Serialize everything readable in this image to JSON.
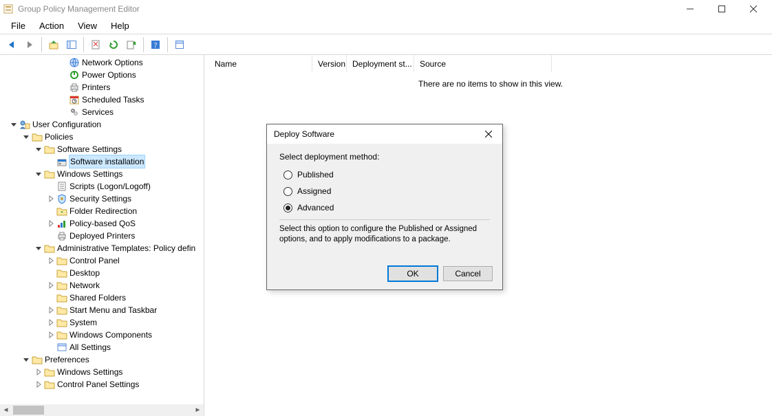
{
  "window": {
    "title": "Group Policy Management Editor"
  },
  "menubar": [
    "File",
    "Action",
    "View",
    "Help"
  ],
  "tree": [
    {
      "d": 4,
      "tw": "",
      "ic": "net",
      "label": "Network Options"
    },
    {
      "d": 4,
      "tw": "",
      "ic": "power",
      "label": "Power Options"
    },
    {
      "d": 4,
      "tw": "",
      "ic": "printer",
      "label": "Printers"
    },
    {
      "d": 4,
      "tw": "",
      "ic": "sched",
      "label": "Scheduled Tasks"
    },
    {
      "d": 4,
      "tw": "",
      "ic": "services",
      "label": "Services"
    },
    {
      "d": 0,
      "tw": "open",
      "ic": "usercfg",
      "label": "User Configuration"
    },
    {
      "d": 1,
      "tw": "open",
      "ic": "folder",
      "label": "Policies"
    },
    {
      "d": 2,
      "tw": "open",
      "ic": "folder",
      "label": "Software Settings",
      "sel": false
    },
    {
      "d": 3,
      "tw": "",
      "ic": "swinst",
      "label": "Software installation",
      "sel": true
    },
    {
      "d": 2,
      "tw": "open",
      "ic": "folder",
      "label": "Windows Settings"
    },
    {
      "d": 3,
      "tw": "",
      "ic": "script",
      "label": "Scripts (Logon/Logoff)"
    },
    {
      "d": 3,
      "tw": "closed",
      "ic": "sec",
      "label": "Security Settings"
    },
    {
      "d": 3,
      "tw": "",
      "ic": "folderredir",
      "label": "Folder Redirection"
    },
    {
      "d": 3,
      "tw": "closed",
      "ic": "qos",
      "label": "Policy-based QoS"
    },
    {
      "d": 3,
      "tw": "",
      "ic": "depprint",
      "label": "Deployed Printers"
    },
    {
      "d": 2,
      "tw": "open",
      "ic": "folder",
      "label": "Administrative Templates: Policy defin"
    },
    {
      "d": 3,
      "tw": "closed",
      "ic": "folder",
      "label": "Control Panel"
    },
    {
      "d": 3,
      "tw": "",
      "ic": "folder",
      "label": "Desktop"
    },
    {
      "d": 3,
      "tw": "closed",
      "ic": "folder",
      "label": "Network"
    },
    {
      "d": 3,
      "tw": "",
      "ic": "folder",
      "label": "Shared Folders"
    },
    {
      "d": 3,
      "tw": "closed",
      "ic": "folder",
      "label": "Start Menu and Taskbar"
    },
    {
      "d": 3,
      "tw": "closed",
      "ic": "folder",
      "label": "System"
    },
    {
      "d": 3,
      "tw": "closed",
      "ic": "folder",
      "label": "Windows Components"
    },
    {
      "d": 3,
      "tw": "",
      "ic": "allset",
      "label": "All Settings"
    },
    {
      "d": 1,
      "tw": "open",
      "ic": "folder",
      "label": "Preferences"
    },
    {
      "d": 2,
      "tw": "closed",
      "ic": "folder",
      "label": "Windows Settings"
    },
    {
      "d": 2,
      "tw": "closed",
      "ic": "folder",
      "label": "Control Panel Settings"
    }
  ],
  "list": {
    "columns": [
      "Name",
      "Version",
      "Deployment st...",
      "Source"
    ],
    "empty": "There are no items to show in this view."
  },
  "dialog": {
    "title": "Deploy Software",
    "prompt": "Select deployment method:",
    "options": [
      "Published",
      "Assigned",
      "Advanced"
    ],
    "selected": 2,
    "description": "Select this option to configure the Published or Assigned options, and to apply modifications to a package.",
    "ok": "OK",
    "cancel": "Cancel"
  }
}
